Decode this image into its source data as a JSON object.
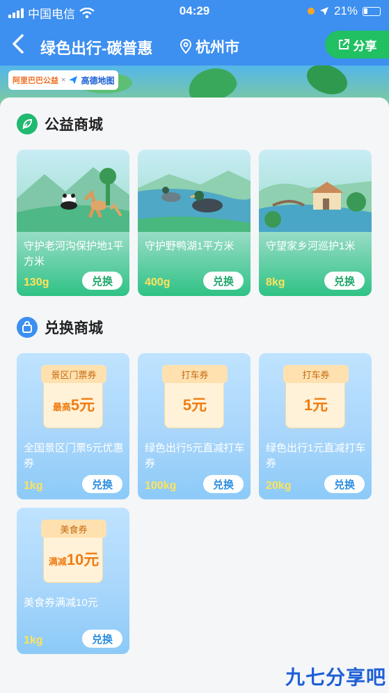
{
  "status_bar": {
    "carrier": "中国电信",
    "time": "04:29",
    "battery": "21%"
  },
  "nav": {
    "title": "绿色出行-碳普惠",
    "city": "杭州市",
    "share_label": "分享"
  },
  "partners": {
    "left": "阿里巴巴公益",
    "separator": "×",
    "right": "高德地图"
  },
  "sections": [
    {
      "title": "公益商城",
      "items": [
        {
          "name": "守护老河沟保护地1平方米",
          "price": "130g",
          "button": "兑换"
        },
        {
          "name": "守护野鸭湖1平方米",
          "price": "400g",
          "button": "兑换"
        },
        {
          "name": "守望家乡河巡护1米",
          "price": "8kg",
          "button": "兑换"
        }
      ]
    },
    {
      "title": "兑换商城",
      "items": [
        {
          "name": "全国景区门票5元优惠券",
          "price": "1kg",
          "button": "兑换",
          "ticket_tag": "景区门票券",
          "ticket_prefix": "最高",
          "ticket_value": "5元"
        },
        {
          "name": "绿色出行5元直减打车券",
          "price": "100kg",
          "button": "兑换",
          "ticket_tag": "打车券",
          "ticket_prefix": "",
          "ticket_value": "5元"
        },
        {
          "name": "绿色出行1元直减打车券",
          "price": "20kg",
          "button": "兑换",
          "ticket_tag": "打车券",
          "ticket_prefix": "",
          "ticket_value": "1元"
        },
        {
          "name": "美食券满减10元",
          "price": "1kg",
          "button": "兑换",
          "ticket_tag": "美食券",
          "ticket_prefix": "满减",
          "ticket_value": "10元"
        }
      ]
    }
  ],
  "watermark": "九七分享吧",
  "colors": {
    "header_blue": "#3d8ff0",
    "share_green": "#21c063",
    "price_yellow": "#ffe35a",
    "ticket_orange": "#f07c12"
  }
}
